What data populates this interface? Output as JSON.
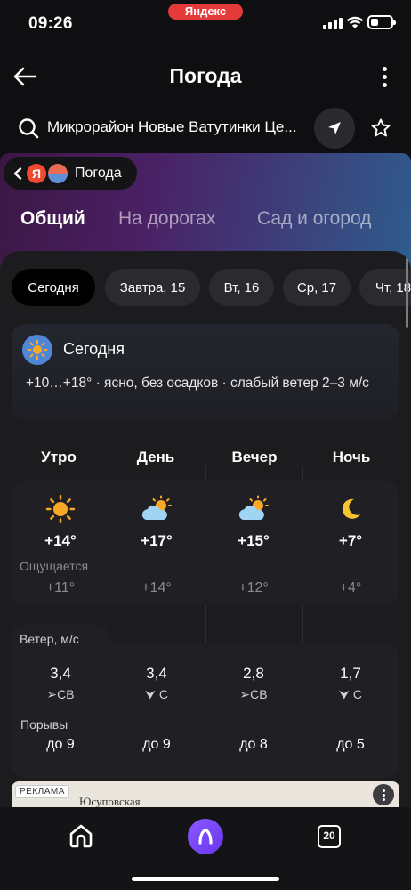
{
  "status_bar": {
    "time": "09:26",
    "badge": "Яндекс"
  },
  "header": {
    "title": "Погода"
  },
  "search": {
    "query": "Микрорайон Новые Ватутинки Це..."
  },
  "chip": {
    "logo_letter": "Я",
    "label": "Погода"
  },
  "tabs": [
    {
      "label": "Общий",
      "active": true
    },
    {
      "label": "На дорогах",
      "active": false
    },
    {
      "label": "Сад и огород",
      "active": false
    }
  ],
  "days": [
    {
      "label": "Сегодня",
      "active": true
    },
    {
      "label": "Завтра, 15",
      "active": false
    },
    {
      "label": "Вт, 16",
      "active": false
    },
    {
      "label": "Ср, 17",
      "active": false
    },
    {
      "label": "Чт, 18",
      "active": false
    }
  ],
  "today": {
    "title": "Сегодня",
    "description": "+10…+18° · ясно, без осадков · слабый ветер 2–3 м/с"
  },
  "parts": [
    {
      "name": "Утро",
      "icon": "sun-icon",
      "temp": "+14°",
      "feels": "+11°",
      "wind_speed": "3,4",
      "wind_dir": "СВ",
      "gust": "до 9"
    },
    {
      "name": "День",
      "icon": "partly-cloudy-icon",
      "temp": "+17°",
      "feels": "+14°",
      "wind_speed": "3,4",
      "wind_dir": "С",
      "gust": "до 9"
    },
    {
      "name": "Вечер",
      "icon": "partly-cloudy-icon",
      "temp": "+15°",
      "feels": "+12°",
      "wind_speed": "2,8",
      "wind_dir": "СВ",
      "gust": "до 8"
    },
    {
      "name": "Ночь",
      "icon": "moon-icon",
      "temp": "+7°",
      "feels": "+4°",
      "wind_speed": "1,7",
      "wind_dir": "С",
      "gust": "до 5"
    }
  ],
  "labels": {
    "feels": "Ощущается",
    "wind": "Ветер, м/с",
    "gusts": "Порывы"
  },
  "ad": {
    "tag": "РЕКЛАМА",
    "name": "Юсуповская"
  },
  "bottom_nav": {
    "tabs_count": "20"
  },
  "colors": {
    "accent": "#7a46ff",
    "badge": "#e53a3a",
    "sun": "#f9a825",
    "moon": "#f9c431"
  }
}
